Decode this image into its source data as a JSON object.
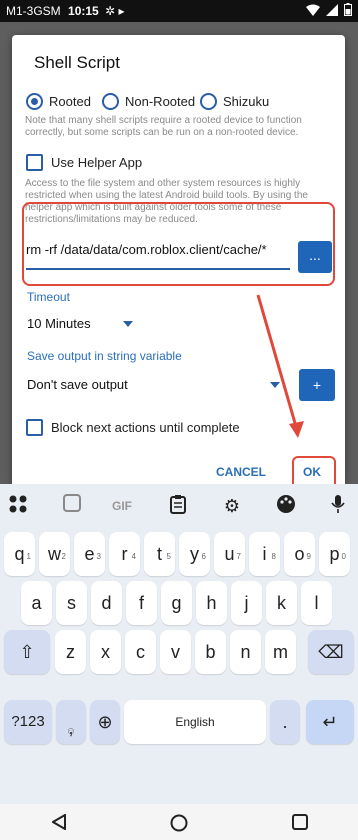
{
  "status": {
    "carrier": "M1-3GSM",
    "time": "10:15"
  },
  "dialog": {
    "title": "Shell Script",
    "radios": [
      {
        "label": "Rooted",
        "selected": true
      },
      {
        "label": "Non-Rooted",
        "selected": false
      },
      {
        "label": "Shizuku",
        "selected": false
      }
    ],
    "rooted_note": "Note that many shell scripts require a rooted device to function correctly, but some scripts can be run on a non-rooted device.",
    "helper_label": "Use Helper App",
    "helper_note": "Access to the file system and other system resources is highly restricted when using the latest Android build tools. By using the helper app which is built against older tools some of these restrictions/limitations may be reduced.",
    "command_value": "rm -rf /data/data/com.roblox.client/cache/*",
    "dots_button": "...",
    "timeout_label": "Timeout",
    "timeout_value": "10 Minutes",
    "save_output_label": "Save output in string variable",
    "save_output_value": "Don't save output",
    "plus_button": "+",
    "block_label": "Block next actions until complete",
    "cancel": "CANCEL",
    "ok": "OK"
  },
  "keyboard": {
    "toolbar": [
      "apps-icon",
      "sticker-icon",
      "gif-icon",
      "clipboard-icon",
      "settings-icon",
      "palette-icon",
      "mic-icon"
    ],
    "toolbar_gif": "GIF",
    "row1": [
      {
        "k": "q",
        "h": "1"
      },
      {
        "k": "w",
        "h": "2"
      },
      {
        "k": "e",
        "h": "3"
      },
      {
        "k": "r",
        "h": "4"
      },
      {
        "k": "t",
        "h": "5"
      },
      {
        "k": "y",
        "h": "6"
      },
      {
        "k": "u",
        "h": "7"
      },
      {
        "k": "i",
        "h": "8"
      },
      {
        "k": "o",
        "h": "9"
      },
      {
        "k": "p",
        "h": "0"
      }
    ],
    "row2": [
      "a",
      "s",
      "d",
      "f",
      "g",
      "h",
      "j",
      "k",
      "l"
    ],
    "row3": [
      "z",
      "x",
      "c",
      "v",
      "b",
      "n",
      "m"
    ],
    "shift": "⇧",
    "backspace": "⌫",
    "symbols": "?123",
    "emoji_hint": "☺",
    "comma": ",",
    "globe": "⊕",
    "space": "English",
    "period": ".",
    "enter": "↵"
  },
  "colors": {
    "accent": "#2a5fa6",
    "button": "#1f66b8",
    "annotation": "#e0483a"
  }
}
